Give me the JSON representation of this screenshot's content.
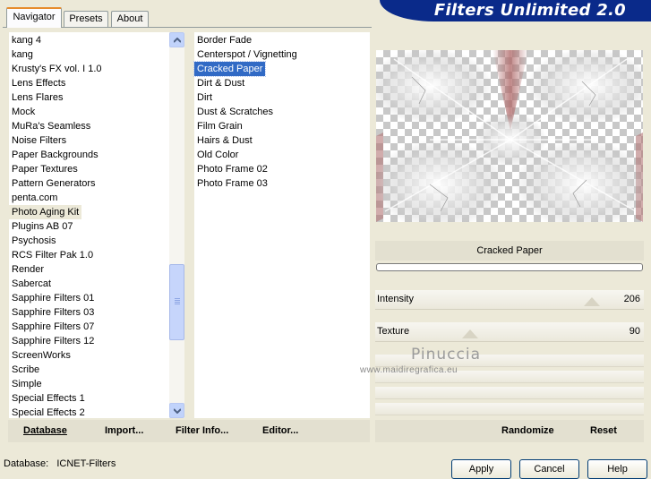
{
  "header": {
    "title": "Filters Unlimited 2.0"
  },
  "tabs": [
    {
      "label": "Navigator",
      "active": true
    },
    {
      "label": "Presets",
      "active": false
    },
    {
      "label": "About",
      "active": false
    }
  ],
  "categories": {
    "items": [
      "kang 4",
      "kang",
      "Krusty's FX vol. I 1.0",
      "Lens Effects",
      "Lens Flares",
      "Mock",
      "MuRa's Seamless",
      "Noise Filters",
      "Paper Backgrounds",
      "Paper Textures",
      "Pattern Generators",
      "penta.com",
      "Photo Aging Kit",
      "Plugins AB 07",
      "Psychosis",
      "RCS Filter Pak 1.0",
      "Render",
      "Sabercat",
      "Sapphire Filters 01",
      "Sapphire Filters 03",
      "Sapphire Filters 07",
      "Sapphire Filters 12",
      "ScreenWorks",
      "Scribe",
      "Simple",
      "Special Effects 1",
      "Special Effects 2"
    ],
    "selected": "Photo Aging Kit"
  },
  "filters": {
    "items": [
      "Border Fade",
      "Centerspot / Vignetting",
      "Cracked Paper",
      "Dirt & Dust",
      "Dirt",
      "Dust & Scratches",
      "Film Grain",
      "Hairs & Dust",
      "Old Color",
      "Photo Frame 02",
      "Photo Frame 03"
    ],
    "selected": "Cracked Paper"
  },
  "filter_name": "Cracked Paper",
  "progress": 0,
  "sliders": [
    {
      "label": "Intensity",
      "value": "206",
      "level": 206,
      "max": 255
    },
    {
      "label": "Texture",
      "value": "90",
      "level": 90,
      "max": 255
    }
  ],
  "bottom_left": {
    "database": "Database",
    "import": "Import...",
    "filter_info": "Filter Info...",
    "editor": "Editor..."
  },
  "bottom_right": {
    "randomize": "Randomize",
    "reset": "Reset"
  },
  "status": {
    "label": "Database:",
    "value": "ICNET-Filters"
  },
  "buttons": {
    "apply": "Apply",
    "cancel": "Cancel",
    "help": "Help"
  },
  "watermark": {
    "title": "Pinuccia",
    "url": "www.maidiregrafica.eu"
  },
  "colors": {
    "banner": "#0a2a8a",
    "selection": "#316ac5",
    "tab_accent": "#e68b2c",
    "window": "#ece9d8"
  },
  "icons": {
    "scroll_up": "chevron-up-icon",
    "scroll_down": "chevron-down-icon"
  }
}
